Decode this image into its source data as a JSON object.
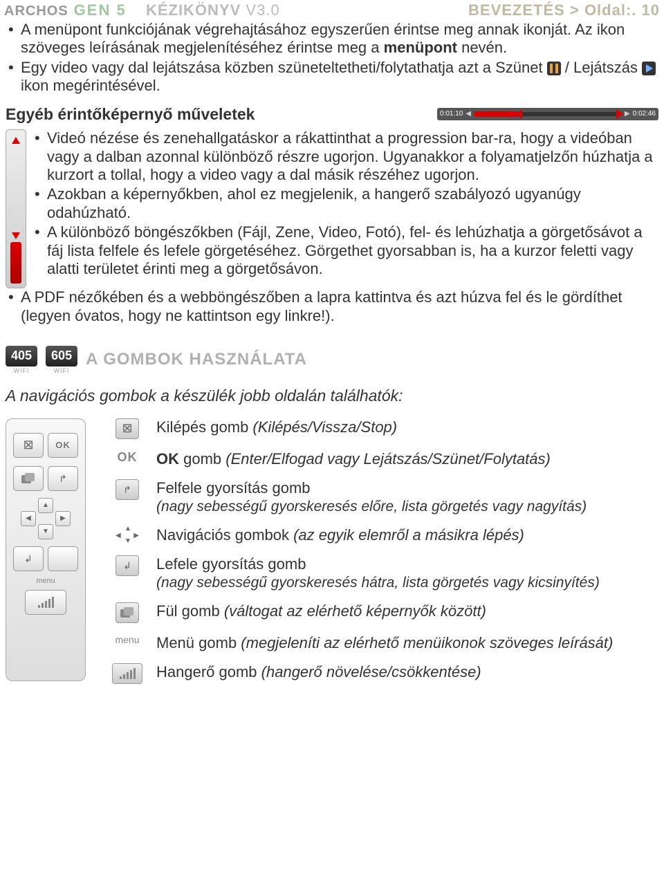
{
  "header": {
    "brand": "ARCHOS",
    "gen": "GEN 5",
    "manual_label": "KÉZIKÖNYV",
    "manual_version": "V3.0",
    "section": "BEVEZETÉS",
    "sep": ">",
    "page_label": "Oldal:.",
    "page_num": "10"
  },
  "top_bullets": {
    "b1a": "A menüpont funkciójának végrehajtásához egyszerűen érintse meg annak ikonját. Az ikon szöveges leírásának megjelenítéséhez érintse meg a ",
    "b1b": "menüpont",
    "b1c": " nevén.",
    "b2a": "Egy video vagy dal lejátszása közben szüneteltetheti/folytathatja azt a Szünet ",
    "b2b": " / Lejátszás ",
    "b2c": " ikon megérintésével."
  },
  "other_ops_heading": "Egyéb érintőképernyő műveletek",
  "scrubber": {
    "left": "0:01:10",
    "right": "0:02:46"
  },
  "mid_bullets": {
    "m1": "Videó nézése és zenehallgatáskor a rákattinthat a progression bar-ra, hogy a videóban vagy a dalban azonnal különböző részre ugorjon. Ugyanakkor a folyamatjelzőn húzhatja a kurzort a tollal, hogy a video vagy a dal másik részéhez ugorjon.",
    "m2": "Azokban a képernyőkben, ahol ez megjelenik, a hangerő szabályozó ugyanúgy odahúzható.",
    "m3": "A különböző böngészőkben (Fájl, Zene, Video, Fotó), fel- és lehúzhatja a görgetősávot a fáj lista felfele és lefele görgetéséhez. Görgethet gyorsabban is, ha a kurzor feletti vagy alatti területet érinti meg a görgetősávon.",
    "m4": "A PDF nézőkében és a webböngészőben a lapra kattintva és azt húzva fel és le gördíthet (legyen óvatos, hogy ne kattintson egy linkre!)."
  },
  "badges": {
    "a": "405",
    "b": "605",
    "sub": "WIFI"
  },
  "buttons_title": "A GOMBOK HASZNÁLATA",
  "buttons_intro": "A navigációs gombok a készülék jobb oldalán találhatók:",
  "panel": {
    "ok": "OK",
    "menu": "menu"
  },
  "buttons": [
    {
      "name_b": "Kilépés gomb",
      "sub": " (Kilépés/Vissza/Stop)"
    },
    {
      "name_a": "OK ",
      "name_b": "gomb",
      "sub": " (Enter/Elfogad vagy Lejátszás/Szünet/Folytatás)"
    },
    {
      "name_b": "Felfele gyorsítás gomb",
      "subline": "(nagy sebességű gyorskeresés előre, lista görgetés vagy nagyítás)"
    },
    {
      "name_b": "Navigációs gombok",
      "sub": " (az egyik elemről a másikra lépés)"
    },
    {
      "name_b": "Lefele gyorsítás gomb",
      "subline": "(nagy sebességű gyorskeresés hátra, lista görgetés vagy kicsinyítés)"
    },
    {
      "name_b": "Fül gomb",
      "sub": " (váltogat az elérhető képernyők között)"
    },
    {
      "name_b": "Menü gomb",
      "sub": " (megjeleníti az elérhető menüikonok szöveges leírását)"
    },
    {
      "name_b": "Hangerő gomb",
      "sub": " (hangerő növelése/csökkentése)"
    }
  ]
}
